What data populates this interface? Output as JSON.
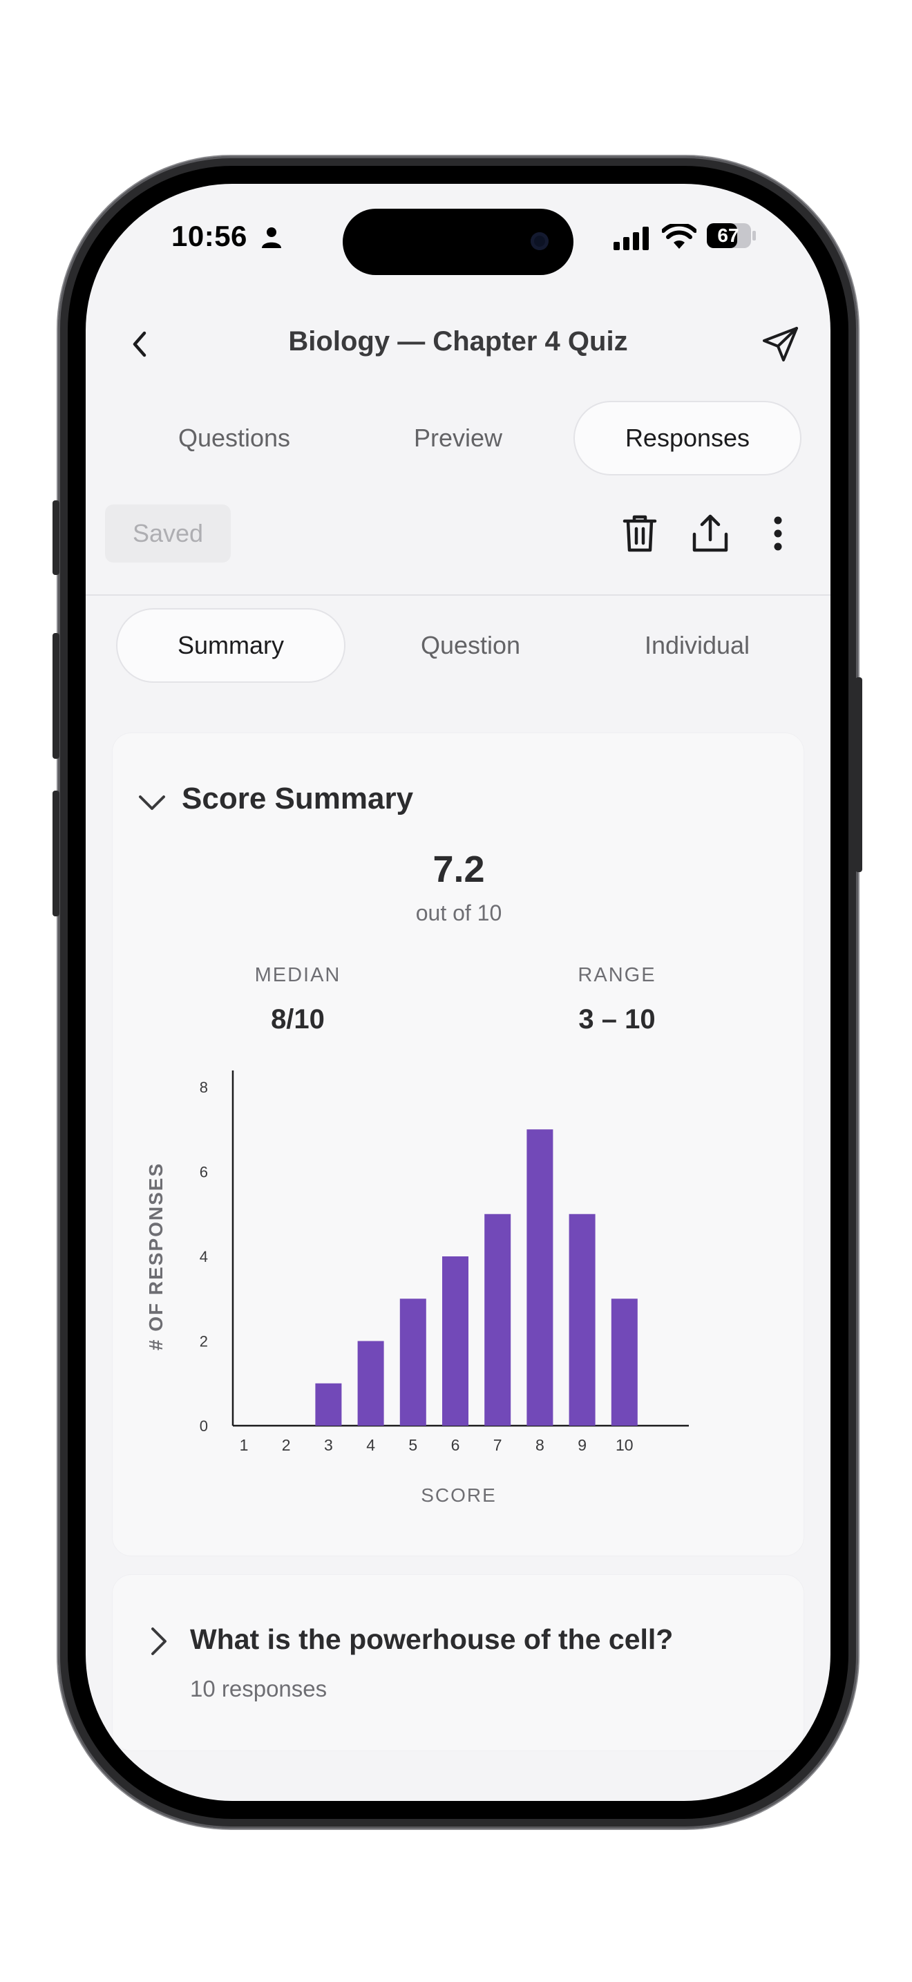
{
  "status_bar": {
    "time": "10:56",
    "battery": "67"
  },
  "nav": {
    "title": "Biology — Chapter 4 Quiz"
  },
  "top_tabs": [
    {
      "label": "Questions",
      "active": false
    },
    {
      "label": "Preview",
      "active": false
    },
    {
      "label": "Responses",
      "active": true
    }
  ],
  "toolbar": {
    "saved_label": "Saved"
  },
  "sub_tabs": [
    {
      "label": "Summary",
      "active": true
    },
    {
      "label": "Question",
      "active": false
    },
    {
      "label": "Individual",
      "active": false
    }
  ],
  "score_summary": {
    "title": "Score Summary",
    "average": "7.2",
    "out_of": "out of 10",
    "median_label": "MEDIAN",
    "median_value": "8/10",
    "range_label": "RANGE",
    "range_value": "3 – 10"
  },
  "chart_data": {
    "type": "bar",
    "categories": [
      "1",
      "2",
      "3",
      "4",
      "5",
      "6",
      "7",
      "8",
      "9",
      "10"
    ],
    "values": [
      0,
      0,
      1,
      2,
      3,
      4,
      5,
      7,
      5,
      3
    ],
    "xlabel": "SCORE",
    "ylabel": "# OF RESPONSES",
    "ylim": [
      0,
      8
    ],
    "yticks": [
      "0",
      "2",
      "4",
      "6",
      "8"
    ],
    "bar_color": "#7249b8",
    "grid": false
  },
  "question_card": {
    "title": "What is the powerhouse of the cell?",
    "responses": "10 responses"
  }
}
